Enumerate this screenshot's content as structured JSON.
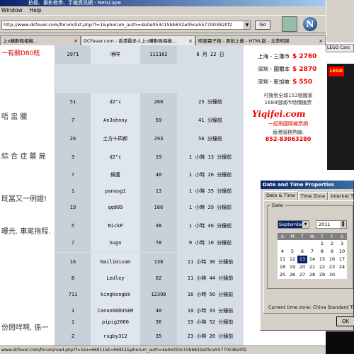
{
  "window": {
    "title": "拍檔、攝影教學、手機資訊網 - Netscape",
    "menu": [
      "Window",
      "Help"
    ],
    "url": "http://www.dcfever.com/forum/list.php?f=1&phorum_auth=4e0e053c15bb832e05ce5577003820f2",
    "go_label": "Go",
    "logo": "N",
    "tabs": [
      {
        "label": "上o購數碼相機..."
      },
      {
        "label": "DCFever.com - 香港最多人上o購數碼相機..."
      },
      {
        "label": "明報電子報 - 原創上載 - HTML版 - 北美明報"
      }
    ],
    "status": "www.dcfever.com/forum/read.php?f=1&i=66911&t=66911&phorum_auth=4e0e053c15bb832e05ce5577003820f2"
  },
  "left_snippets": [
    {
      "text": "一有關D80既",
      "red": true
    },
    {
      "text": "唔 盅 臘",
      "red": false
    },
    {
      "text": "綜 合 症 墓 屍",
      "red": false
    },
    {
      "text": "既冨又一例證!",
      "red": false
    },
    {
      "text": "曝光. 車尾拖程.",
      "red": false
    },
    {
      "text": "份問咩啊, 係一",
      "red": false
    }
  ],
  "forum_rows": [
    {
      "replies": "2971",
      "author": "唄咩",
      "views": "111102",
      "time": "8 月 22 日"
    },
    {
      "replies": "51",
      "author": "d2\"c",
      "views": "260",
      "time": "25 分鐘前"
    },
    {
      "replies": "7",
      "author": "AnJohnny",
      "views": "59",
      "time": "41 分鐘前"
    },
    {
      "replies": "26",
      "author": "土方十四郎",
      "views": "293",
      "time": "56 分鐘前"
    },
    {
      "replies": "3",
      "author": "d2\"c",
      "views": "19",
      "time": "1 小時 13 分鐘前"
    },
    {
      "replies": "7",
      "author": "鍋蘆",
      "views": "40",
      "time": "1 小時 26 分鐘前"
    },
    {
      "replies": "1",
      "author": "panasg1",
      "views": "13",
      "time": "1 小時 35 分鐘前"
    },
    {
      "replies": "19",
      "author": "qq809",
      "views": "166",
      "time": "1 小時 39 分鐘前"
    },
    {
      "replies": "5",
      "author": "NickP",
      "views": "38",
      "time": "1 小時 46 分鐘前"
    },
    {
      "replies": "7",
      "author": "Sugo",
      "views": "78",
      "time": "9 小時 10 分鐘前"
    },
    {
      "replies": "16",
      "author": "Nailimixam",
      "views": "138",
      "time": "11 小時 30 分鐘前"
    },
    {
      "replies": "8",
      "author": "Ledley",
      "views": "62",
      "time": "11 小時 44 分鐘前"
    },
    {
      "replies": "711",
      "author": "kingkongbk",
      "views": "12398",
      "time": "16 小時 50 分鐘前"
    },
    {
      "replies": "1",
      "author": "Canon60DUSER",
      "views": "40",
      "time": "19 小時 33 分鐘前"
    },
    {
      "replies": "1",
      "author": "pipig2000",
      "views": "36",
      "time": "19 小時 52 分鐘前"
    },
    {
      "replies": "2",
      "author": "rugby312",
      "views": "35",
      "time": "23 小時 20 分鐘前"
    }
  ],
  "ad": {
    "prices": [
      {
        "route": "上海 - 三藩市",
        "price": "$ 2760"
      },
      {
        "route": "深圳 - 圖爾本",
        "price": "$ 2870"
      },
      {
        "route": "深圳 - 新加坡",
        "price": "$ 550"
      }
    ],
    "line1": "可搜索全球152個國家",
    "line2": "1688個城市特價機票",
    "brand": "Yiqifei.com",
    "tagline": "一起飛國際機票網",
    "hotline_label": "香港服務熱線:",
    "hotline": "852-83063280"
  },
  "right_window": {
    "tab": "LEGO Cars",
    "brand": "LEGO"
  },
  "dialog": {
    "title": "Date and Time Properties",
    "tabs": [
      "Date & Time",
      "Time Zone",
      "Internet Time"
    ],
    "group_label": "Date",
    "month": "September",
    "year": "2011",
    "weekdays": [
      "S",
      "M",
      "T",
      "W",
      "T",
      "F",
      "S"
    ],
    "days": [
      "",
      "",
      "",
      "",
      "1",
      "2",
      "3",
      "4",
      "5",
      "6",
      "7",
      "8",
      "9",
      "10",
      "11",
      "12",
      "13",
      "14",
      "15",
      "16",
      "17",
      "18",
      "19",
      "20",
      "21",
      "22",
      "23",
      "24",
      "25",
      "26",
      "27",
      "28",
      "29",
      "30",
      ""
    ],
    "selected_day": "13",
    "timezone": "Current time zone:  China Standard Time",
    "ok_label": "OK"
  }
}
